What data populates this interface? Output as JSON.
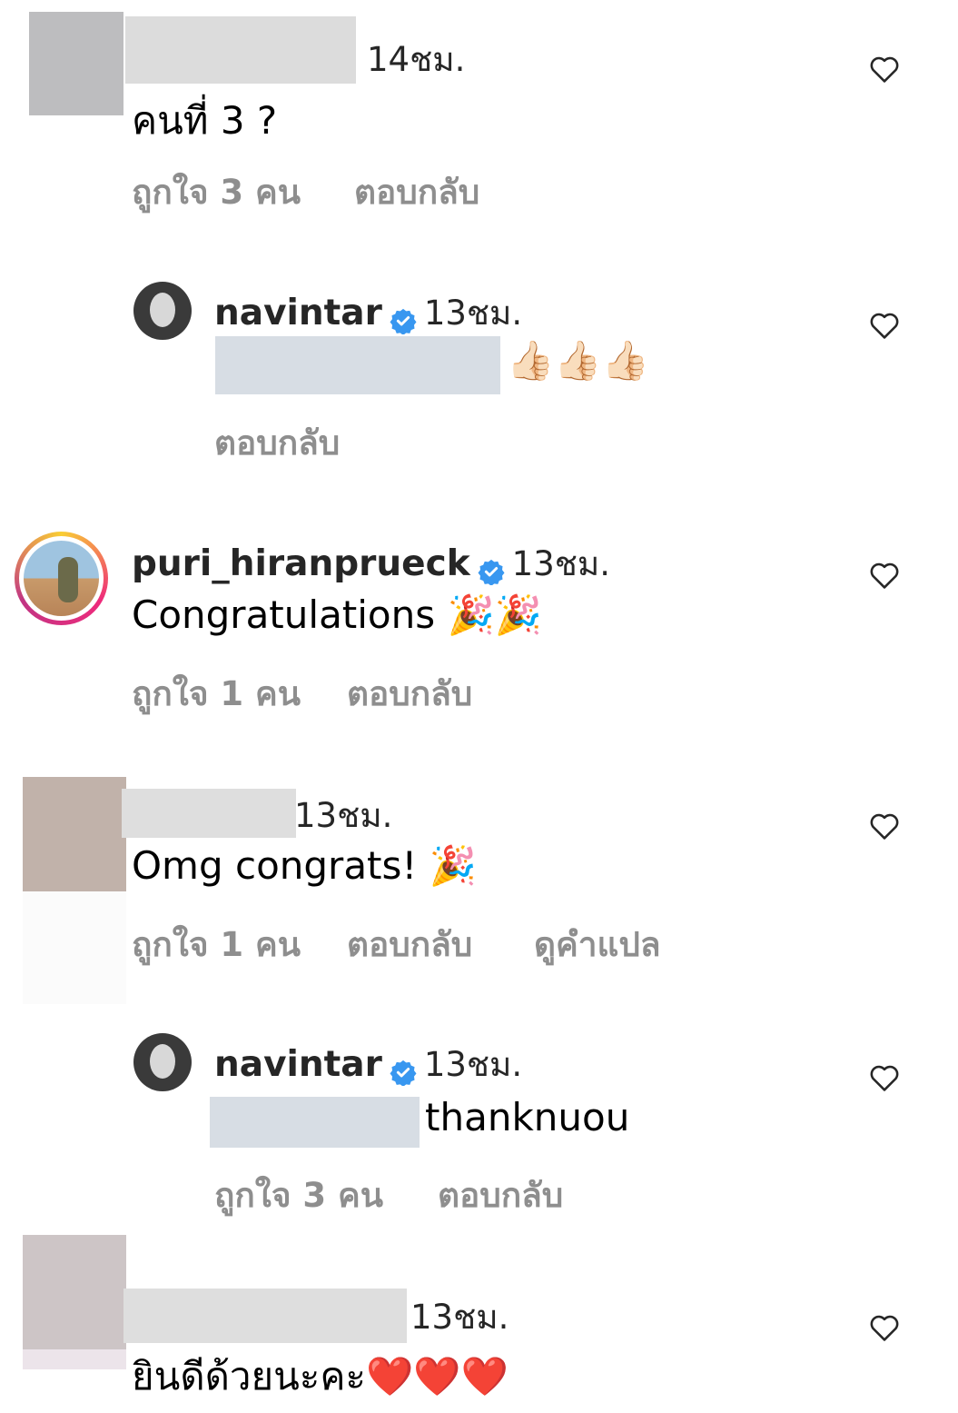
{
  "comments": [
    {
      "time": "14ชม.",
      "text": "คนที่ 3 ?",
      "likes": "ถูกใจ 3 คน",
      "reply": "ตอบกลับ"
    },
    {
      "username": "navintar",
      "time": "13ชม.",
      "text": "👍🏻👍🏻👍🏻",
      "reply": "ตอบกลับ"
    },
    {
      "username": "puri_hiranprueck",
      "time": "13ชม.",
      "text": "Congratulations 🎉🎉",
      "likes": "ถูกใจ 1 คน",
      "reply": "ตอบกลับ"
    },
    {
      "time": "13ชม.",
      "text": "Omg congrats! 🎉",
      "likes": "ถูกใจ 1 คน",
      "reply": "ตอบกลับ",
      "translate": "ดูคำแปล"
    },
    {
      "username": "navintar",
      "time": "13ชม.",
      "text": "thanknuou",
      "likes": "ถูกใจ 3 คน",
      "reply": "ตอบกลับ"
    },
    {
      "time": "13ชม.",
      "text": "ยินดีด้วยนะคะ❤️❤️❤️"
    }
  ],
  "icons": {
    "like": "heart-outline-icon",
    "verified": "verified-badge-icon"
  },
  "colors": {
    "verified": "#3897f0",
    "meta": "#8e8e8e",
    "story_ring_start": "#f9ce34",
    "story_ring_end": "#c13584"
  }
}
